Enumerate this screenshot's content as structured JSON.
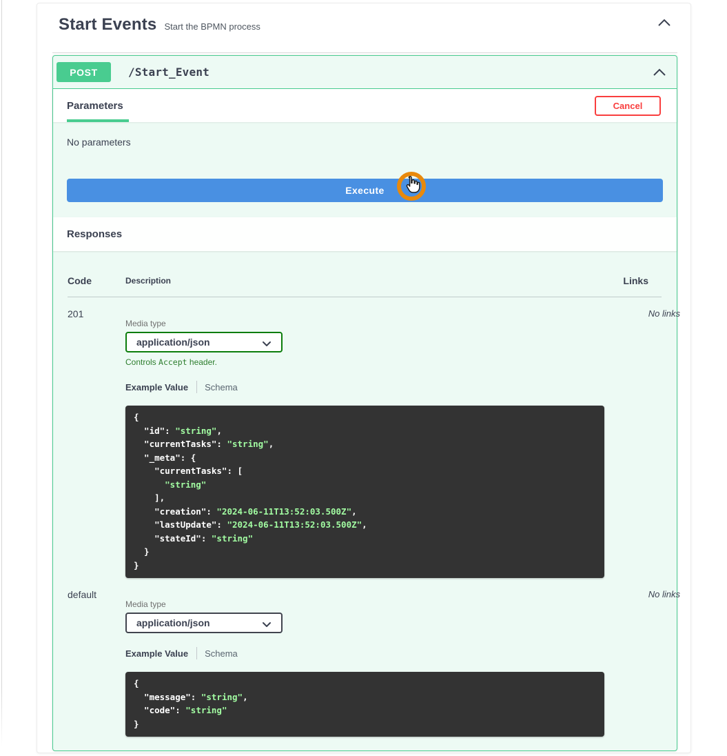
{
  "section": {
    "title": "Start Events",
    "subtitle": "Start the BPMN process"
  },
  "operation": {
    "method": "POST",
    "path": "/Start_Event"
  },
  "parameters": {
    "tab_label": "Parameters",
    "cancel_label": "Cancel",
    "empty_message": "No parameters",
    "execute_label": "Execute"
  },
  "responses": {
    "title": "Responses",
    "headers": {
      "code": "Code",
      "description": "Description",
      "links": "Links"
    },
    "rows": [
      {
        "code": "201",
        "links": "No links",
        "media_type_label": "Media type",
        "media_type_value": "application/json",
        "accept_note": {
          "prefix": "Controls ",
          "code": "Accept",
          "suffix": " header."
        },
        "tabs": {
          "example": "Example Value",
          "schema": "Schema"
        },
        "example_lines": [
          [
            [
              "{",
              "p"
            ]
          ],
          [
            [
              "  \"id\"",
              "k"
            ],
            [
              ": ",
              "p"
            ],
            [
              "\"string\"",
              "s"
            ],
            [
              ",",
              "p"
            ]
          ],
          [
            [
              "  \"currentTasks\"",
              "k"
            ],
            [
              ": ",
              "p"
            ],
            [
              "\"string\"",
              "s"
            ],
            [
              ",",
              "p"
            ]
          ],
          [
            [
              "  \"_meta\"",
              "k"
            ],
            [
              ": {",
              "p"
            ]
          ],
          [
            [
              "    \"currentTasks\"",
              "k"
            ],
            [
              ": [",
              "p"
            ]
          ],
          [
            [
              "      \"string\"",
              "s"
            ]
          ],
          [
            [
              "    ],",
              "p"
            ]
          ],
          [
            [
              "    \"creation\"",
              "k"
            ],
            [
              ": ",
              "p"
            ],
            [
              "\"2024-06-11T13:52:03.500Z\"",
              "s"
            ],
            [
              ",",
              "p"
            ]
          ],
          [
            [
              "    \"lastUpdate\"",
              "k"
            ],
            [
              ": ",
              "p"
            ],
            [
              "\"2024-06-11T13:52:03.500Z\"",
              "s"
            ],
            [
              ",",
              "p"
            ]
          ],
          [
            [
              "    \"stateId\"",
              "k"
            ],
            [
              ": ",
              "p"
            ],
            [
              "\"string\"",
              "s"
            ]
          ],
          [
            [
              "  }",
              "p"
            ]
          ],
          [
            [
              "}",
              "p"
            ]
          ]
        ]
      },
      {
        "code": "default",
        "links": "No links",
        "media_type_label": "Media type",
        "media_type_value": "application/json",
        "tabs": {
          "example": "Example Value",
          "schema": "Schema"
        },
        "example_lines": [
          [
            [
              "{",
              "p"
            ]
          ],
          [
            [
              "  \"message\"",
              "k"
            ],
            [
              ": ",
              "p"
            ],
            [
              "\"string\"",
              "s"
            ],
            [
              ",",
              "p"
            ]
          ],
          [
            [
              "  \"code\"",
              "k"
            ],
            [
              ": ",
              "p"
            ],
            [
              "\"string\"",
              "s"
            ]
          ],
          [
            [
              "}",
              "p"
            ]
          ]
        ]
      }
    ]
  },
  "colors": {
    "method_green": "#49cc90",
    "mint": "#edfaf4",
    "execute_blue": "#4990e2",
    "cancel_red": "#f93e3e",
    "ink": "#3b4151",
    "code_bg": "#333333",
    "code_string": "#a2fca2",
    "accept_green": "#2d7d2d",
    "select_green_border": "#0b7d0b",
    "select_dark_border": "#41444e",
    "cursor_ring": "#e8890c"
  }
}
